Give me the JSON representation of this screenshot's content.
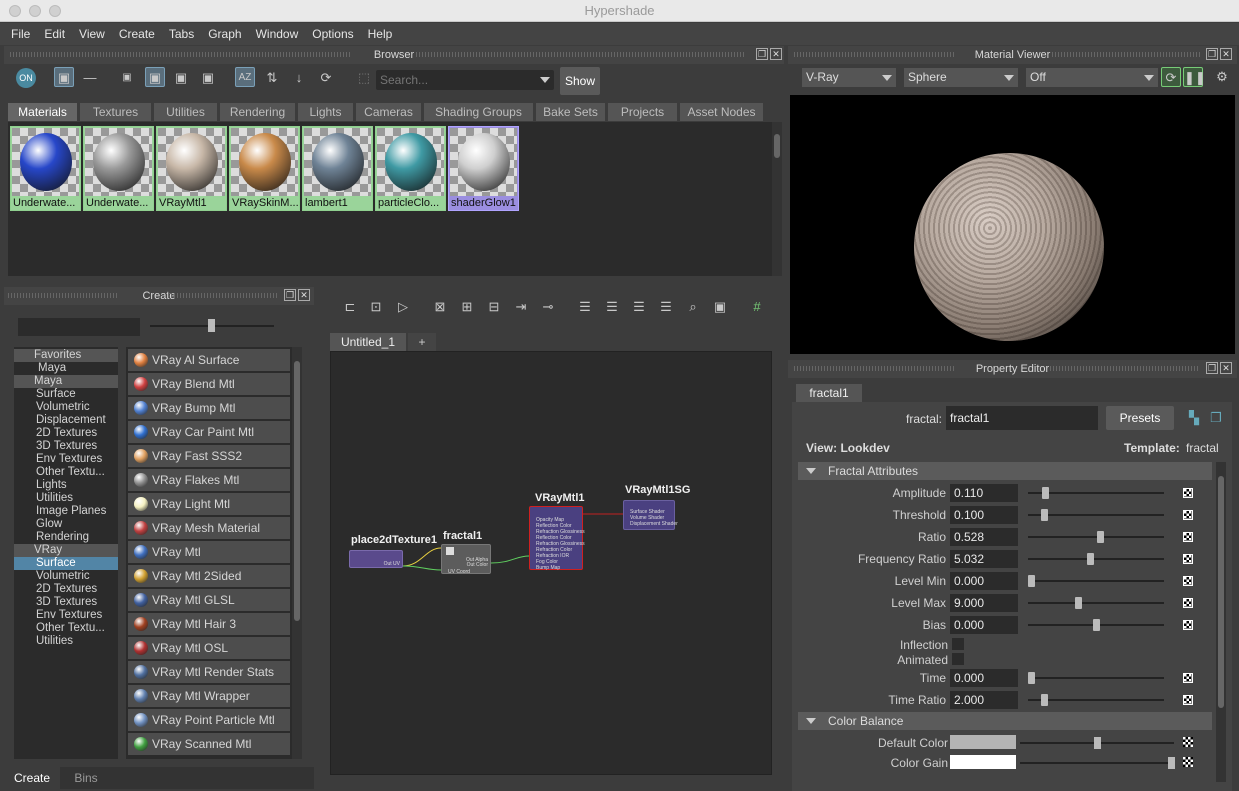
{
  "window": {
    "title": "Hypershade"
  },
  "menu": [
    "File",
    "Edit",
    "View",
    "Create",
    "Tabs",
    "Graph",
    "Window",
    "Options",
    "Help"
  ],
  "browser": {
    "title": "Browser",
    "search_placeholder": "Search...",
    "show_label": "Show",
    "tabs": [
      "Materials",
      "Textures",
      "Utilities",
      "Rendering",
      "Lights",
      "Cameras",
      "Shading Groups",
      "Bake Sets",
      "Projects",
      "Asset Nodes"
    ],
    "materials": [
      {
        "name": "Underwate...",
        "color": "#2747c9"
      },
      {
        "name": "Underwate...",
        "color": "#9a9a9a"
      },
      {
        "name": "VRayMtl1",
        "color": "#c8b8a8"
      },
      {
        "name": "VRaySkinM...",
        "color": "#c98a4a"
      },
      {
        "name": "lambert1",
        "color": "#6f8396"
      },
      {
        "name": "particleClo...",
        "color": "#3f9aa4"
      },
      {
        "name": "shaderGlow1",
        "color": "#cfcfcf"
      }
    ]
  },
  "material_viewer": {
    "title": "Material Viewer",
    "renderer": "V-Ray",
    "shape": "Sphere",
    "mode": "Off"
  },
  "create_panel": {
    "title": "Create",
    "tree": [
      {
        "label": "Favorites",
        "header": true
      },
      {
        "label": "Maya",
        "sub": true
      },
      {
        "label": "Maya",
        "header": true
      },
      {
        "label": "Surface"
      },
      {
        "label": "Volumetric"
      },
      {
        "label": "Displacement"
      },
      {
        "label": "2D Textures"
      },
      {
        "label": "3D Textures"
      },
      {
        "label": "Env Textures"
      },
      {
        "label": "Other Textu..."
      },
      {
        "label": "Lights"
      },
      {
        "label": "Utilities"
      },
      {
        "label": "Image Planes"
      },
      {
        "label": "Glow"
      },
      {
        "label": "Rendering"
      },
      {
        "label": "VRay",
        "header": true
      },
      {
        "label": "Surface",
        "selected": true
      },
      {
        "label": "Volumetric"
      },
      {
        "label": "2D Textures"
      },
      {
        "label": "3D Textures"
      },
      {
        "label": "Env Textures"
      },
      {
        "label": "Other Textu..."
      },
      {
        "label": "Utilities"
      }
    ],
    "nodes": [
      {
        "label": "VRay Al Surface",
        "icon": "#e08040"
      },
      {
        "label": "VRay Blend Mtl",
        "icon": "#d04040"
      },
      {
        "label": "VRay Bump Mtl",
        "icon": "#5080d0"
      },
      {
        "label": "VRay Car Paint Mtl",
        "icon": "#3070d0"
      },
      {
        "label": "VRay Fast SSS2",
        "icon": "#e0a060"
      },
      {
        "label": "VRay Flakes Mtl",
        "icon": "#909090"
      },
      {
        "label": "VRay Light Mtl",
        "icon": "#f4f0c0"
      },
      {
        "label": "VRay Mesh Material",
        "icon": "#c04040"
      },
      {
        "label": "VRay Mtl",
        "icon": "#4070c0"
      },
      {
        "label": "VRay Mtl 2Sided",
        "icon": "#d0a030"
      },
      {
        "label": "VRay Mtl GLSL",
        "icon": "#4060a0"
      },
      {
        "label": "VRay Mtl Hair 3",
        "icon": "#a04020"
      },
      {
        "label": "VRay Mtl OSL",
        "icon": "#b03030"
      },
      {
        "label": "VRay Mtl Render Stats",
        "icon": "#5070a0"
      },
      {
        "label": "VRay Mtl Wrapper",
        "icon": "#6080b0"
      },
      {
        "label": "VRay Point Particle Mtl",
        "icon": "#7090c0"
      },
      {
        "label": "VRay Scanned Mtl",
        "icon": "#40a040"
      }
    ],
    "bottom_tabs": [
      "Create",
      "Bins"
    ]
  },
  "graph": {
    "tab": "Untitled_1",
    "add_tab": "+",
    "nodes": {
      "place2d": {
        "title": "place2dTexture1",
        "out": "Out UV"
      },
      "fractal": {
        "title": "fractal1",
        "out_alpha": "Out Alpha",
        "out_color": "Out Color",
        "uv": "UV Coord"
      },
      "vraymtl": {
        "title": "VRayMtl1",
        "attrs": [
          "Opacity Map",
          "Reflection Color",
          "Refraction Glossiness",
          "Reflection Color",
          "Refraction Glossiness",
          "Refraction Color",
          "Refraction IOR",
          "Fog Color",
          "Bump Map"
        ]
      },
      "sg": {
        "title": "VRayMtl1SG",
        "attrs": [
          "Surface Shader",
          "Volume Shader",
          "Displacement Shader"
        ]
      }
    }
  },
  "property_editor": {
    "title": "Property Editor",
    "tab": "fractal1",
    "node_label": "fractal:",
    "node_value": "fractal1",
    "presets": "Presets",
    "view": "View: Lookdev",
    "template_label": "Template:",
    "template_value": "fractal",
    "section1": "Fractal Attributes",
    "rows": [
      {
        "label": "Amplitude",
        "value": "0.110",
        "pos": 0.11
      },
      {
        "label": "Threshold",
        "value": "0.100",
        "pos": 0.1
      },
      {
        "label": "Ratio",
        "value": "0.528",
        "pos": 0.528
      },
      {
        "label": "Frequency Ratio",
        "value": "5.032",
        "pos": 0.45
      },
      {
        "label": "Level Min",
        "value": "0.000",
        "pos": 0.0
      },
      {
        "label": "Level Max",
        "value": "9.000",
        "pos": 0.36
      },
      {
        "label": "Bias",
        "value": "0.000",
        "pos": 0.5
      }
    ],
    "inflection": "Inflection",
    "animated": "Animated",
    "rows2": [
      {
        "label": "Time",
        "value": "0.000",
        "pos": 0.0
      },
      {
        "label": "Time Ratio",
        "value": "2.000",
        "pos": 0.1
      }
    ],
    "section2": "Color Balance",
    "default_color": "Default Color",
    "color_gain": "Color Gain",
    "colors": {
      "default": "#b4b4b4",
      "gain": "#ffffff"
    }
  }
}
